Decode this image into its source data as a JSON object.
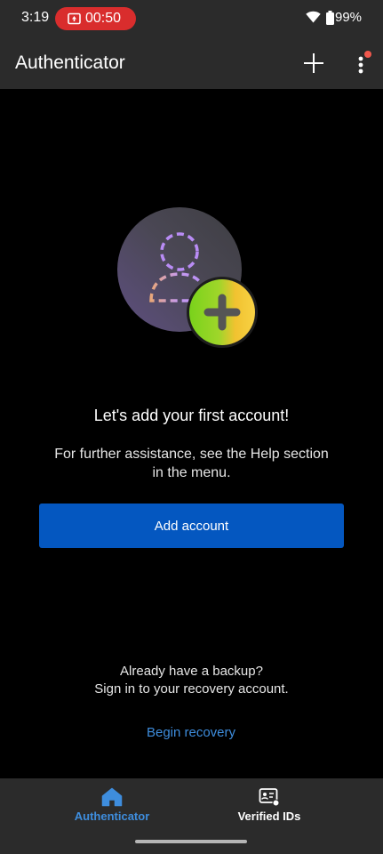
{
  "status_bar": {
    "time": "3:19",
    "recording_time": "00:50",
    "battery": "99%",
    "icons": [
      "screen-record-icon",
      "wifi-icon",
      "battery-icon"
    ]
  },
  "app_bar": {
    "title": "Authenticator",
    "icons": [
      "add-icon",
      "more-options-icon"
    ]
  },
  "empty_state": {
    "heading": "Let's add your first account!",
    "help_text": "For further assistance, see the Help section in the menu.",
    "add_account_label": "Add account",
    "backup_line1": "Already have a backup?",
    "backup_line2": "Sign in to your recovery account.",
    "recovery_link": "Begin recovery"
  },
  "bottom_nav": {
    "items": [
      {
        "label": "Authenticator",
        "icon": "home-icon",
        "active": true
      },
      {
        "label": "Verified IDs",
        "icon": "verified-id-icon",
        "active": false
      }
    ]
  },
  "colors": {
    "bar_background": "#2b2b2b",
    "page_background": "#000000",
    "primary_button": "#0457c0",
    "link": "#3e8ddd",
    "recording_pill": "#d92d2d"
  }
}
